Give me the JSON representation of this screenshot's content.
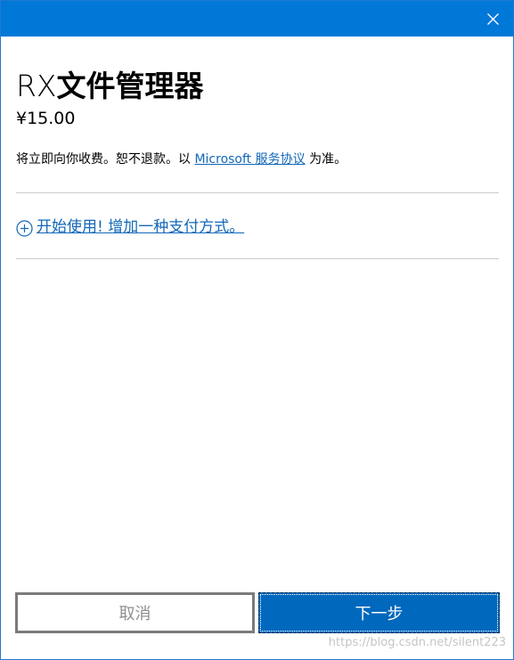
{
  "window": {
    "titlebar_color": "#0078d7",
    "close_icon": "close-icon"
  },
  "product": {
    "title_latin": "RX",
    "title_cjk": "文件管理器",
    "price": "¥15.00"
  },
  "notice": {
    "text_before": "将立即向你收费。恕不退款。以 ",
    "link": "Microsoft 服务协议",
    "text_after": " 为准。"
  },
  "payment": {
    "add_icon": "plus-circle-icon",
    "add_label": "开始使用! 增加一种支付方式。"
  },
  "buttons": {
    "cancel": "取消",
    "next": "下一步"
  },
  "watermark": "https://blog.csdn.net/silent223",
  "colors": {
    "link": "#1267b8",
    "primary_button": "#0068bd",
    "divider": "#cccccc"
  }
}
